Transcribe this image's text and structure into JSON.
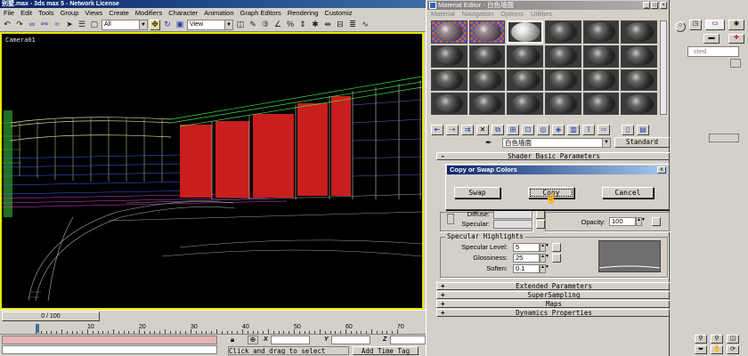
{
  "max_window": {
    "title": "别墅.max - 3ds max 5 - Network License",
    "menu": [
      "File",
      "Edit",
      "Tools",
      "Group",
      "Views",
      "Create",
      "Modifiers",
      "Character",
      "Animation",
      "Graph Editors",
      "Rendering",
      "Customiz"
    ],
    "selection_filter": "All",
    "ref_coord": "View",
    "viewport_label": "Camera01",
    "time_slider": "0 / 100",
    "track_ticks": [
      "0",
      "10",
      "20",
      "30",
      "40",
      "50",
      "60",
      "70"
    ],
    "coord_labels": {
      "x": "X",
      "y": "Y",
      "z": "Z"
    },
    "prompt": "Click and drag to select",
    "add_time_tag": "Add Time Tag"
  },
  "material_editor": {
    "title": "Material Editor - 白色墙面",
    "menu": [
      "Material",
      "Navigation",
      "Options",
      "Utilities"
    ],
    "material_name": "白色墙面",
    "material_type": "Standard",
    "rollouts": {
      "shader_basic": "Shader Basic Parameters",
      "extended": "Extended Parameters",
      "supersampling": "SuperSampling",
      "maps": "Maps",
      "dynamics": "Dynamics Properties"
    },
    "params": {
      "diffuse_label": "Diffuse:",
      "specular_label": "Specular:",
      "opacity_label": "Opacity:",
      "opacity_value": "100",
      "specular_highlights": "Specular Highlights",
      "spec_level_label": "Specular Level:",
      "spec_level_value": "5",
      "glossiness_label": "Glossiness:",
      "glossiness_value": "25",
      "soften_label": "Soften:",
      "soften_value": "0.1"
    }
  },
  "dialog": {
    "title": "Copy or Swap Colors",
    "swap": "Swap",
    "copy": "Copy",
    "cancel": "Cancel",
    "close": "x"
  },
  "command_panel": {
    "field_fragment": "cted"
  },
  "colors": {
    "viewport_border": "#e8e800",
    "title_active": "#0a246a",
    "building_red": "#c81e1e"
  }
}
